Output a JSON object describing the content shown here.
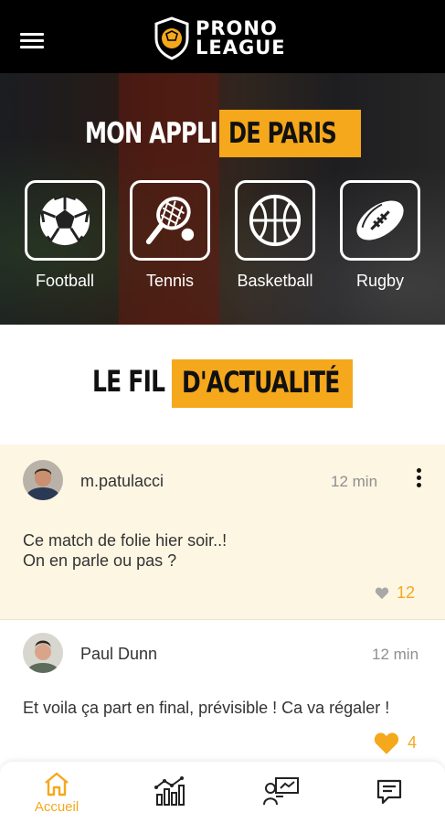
{
  "header": {
    "logo_line1": "PRONO",
    "logo_line2": "LEAGUE",
    "menu_icon": "hamburger-icon"
  },
  "hero": {
    "title_white": "MON APPLI",
    "title_highlight": "DE PARIS",
    "sports": [
      {
        "label": "Football",
        "icon": "soccer-ball-icon"
      },
      {
        "label": "Tennis",
        "icon": "tennis-racket-icon"
      },
      {
        "label": "Basketball",
        "icon": "basketball-icon"
      },
      {
        "label": "Rugby",
        "icon": "rugby-ball-icon"
      }
    ]
  },
  "news": {
    "title_black": "LE FIL",
    "title_highlight": "D'ACTUALITÉ"
  },
  "posts": [
    {
      "user": "m.patulacci",
      "time": "12 min",
      "lines": [
        "Ce match de folie hier soir..!",
        "On en parle ou pas ?"
      ],
      "likes": "12",
      "liked": false
    },
    {
      "user": "Paul Dunn",
      "time": "12 min",
      "lines": [
        "Et voila ça part en final, prévisible ! Ca va régaler !"
      ],
      "likes": "4",
      "liked": true
    }
  ],
  "bottom_nav": {
    "items": [
      {
        "label": "Accueil",
        "icon": "home-icon",
        "active": true
      },
      {
        "label": "",
        "icon": "stats-chart-icon",
        "active": false
      },
      {
        "label": "",
        "icon": "presentation-icon",
        "active": false
      },
      {
        "label": "",
        "icon": "chat-icon",
        "active": false
      }
    ]
  },
  "colors": {
    "accent": "#f5a81c",
    "header_bg": "#000000",
    "post_highlight_bg": "#fdf6e3"
  }
}
